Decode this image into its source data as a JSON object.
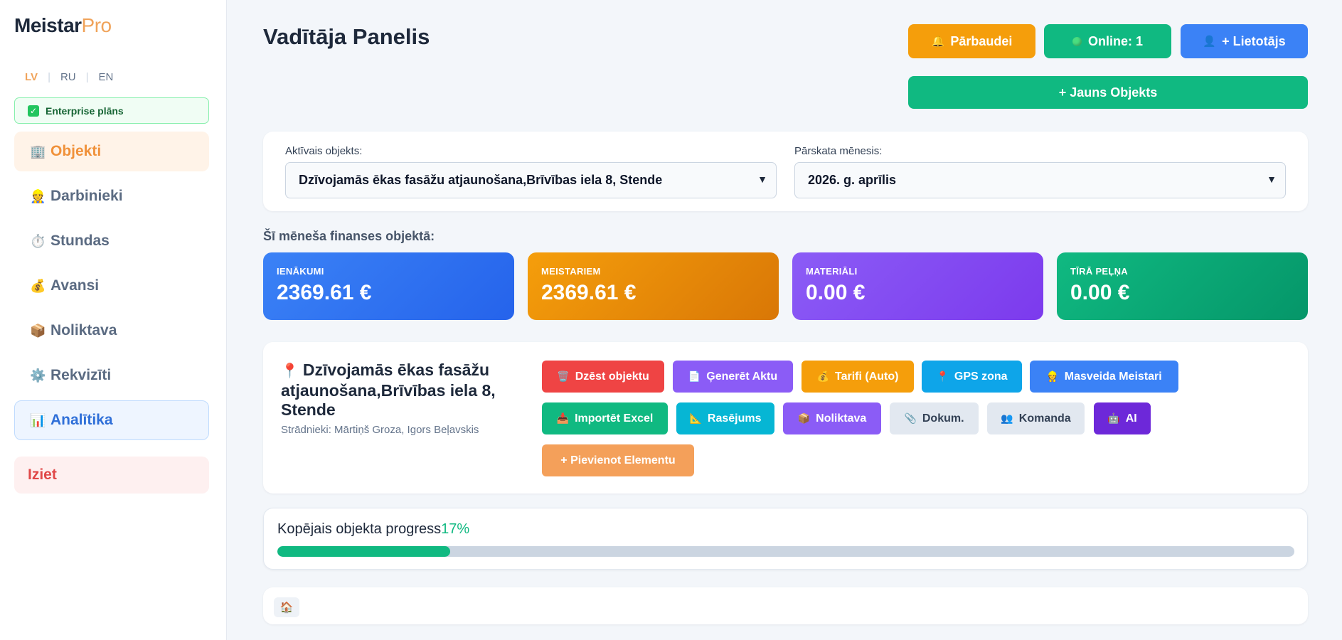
{
  "app": {
    "name_main": "Meistar",
    "name_accent": "Pro"
  },
  "languages": [
    {
      "code": "LV",
      "active": true
    },
    {
      "code": "RU",
      "active": false
    },
    {
      "code": "EN",
      "active": false
    }
  ],
  "plan": {
    "label": "Enterprise plāns",
    "icon": "check-icon"
  },
  "sidebar": {
    "items": [
      {
        "label": "Objekti",
        "icon": "🏢",
        "active": true
      },
      {
        "label": "Darbinieki",
        "icon": "👷"
      },
      {
        "label": "Stundas",
        "icon": "⏱️"
      },
      {
        "label": "Avansi",
        "icon": "💰"
      },
      {
        "label": "Noliktava",
        "icon": "📦"
      },
      {
        "label": "Rekvizīti",
        "icon": "⚙️"
      },
      {
        "label": "Analītika",
        "icon": "📊"
      }
    ],
    "logout": "Iziet"
  },
  "header": {
    "title": "Vadītāja Panelis",
    "check_button": "Pārbaudei",
    "check_icon": "🔔",
    "online_button": "Online: 1",
    "user_button": "+ Lietotājs",
    "user_icon": "👤",
    "new_object_button": "+ Jauns Objekts"
  },
  "filters": {
    "object_label": "Aktīvais objekts:",
    "object_value": "Dzīvojamās ēkas fasāžu atjaunošana,Brīvības iela 8, Stende",
    "month_label": "Pārskata mēnesis:",
    "month_value": "2026. g. aprīlis"
  },
  "finance": {
    "section_title": "Šī mēneša finanses objektā:",
    "income": {
      "label": "IENĀKUMI",
      "value": "2369.61 €"
    },
    "masters": {
      "label": "MEISTARIEM",
      "value": "2369.61 €"
    },
    "materials": {
      "label": "MATERIĀLI",
      "value": "0.00 €"
    },
    "profit": {
      "label": "TĪRĀ PEĻŅA",
      "value": "0.00 €"
    }
  },
  "object": {
    "title": "Dzīvojamās ēkas fasāžu atjaunošana,Brīvības iela 8, Stende",
    "pin_icon": "📍",
    "workers": "Strādnieki: Mārtiņš Groza, Igors Beļavskis",
    "actions": {
      "delete": {
        "label": "Dzēst objektu",
        "icon": "🗑️"
      },
      "act": {
        "label": "Ģenerēt Aktu",
        "icon": "📄"
      },
      "tariffs": {
        "label": "Tarifi (Auto)",
        "icon": "💰"
      },
      "gps": {
        "label": "GPS zona",
        "icon": "📍"
      },
      "bulk": {
        "label": "Masveida Meistari",
        "icon": "👷"
      },
      "import": {
        "label": "Importēt Excel",
        "icon": "📥"
      },
      "drawing": {
        "label": "Rasējums",
        "icon": "📐"
      },
      "warehouse": {
        "label": "Noliktava",
        "icon": "📦"
      },
      "docs": {
        "label": "Dokum.",
        "icon": "📎"
      },
      "team": {
        "label": "Komanda",
        "icon": "👥"
      },
      "ai": {
        "label": "AI",
        "icon": "🤖"
      },
      "add_element": {
        "label": "+ Pievienot Elementu"
      }
    }
  },
  "progress": {
    "label": "Kopējais objekta progress",
    "percent_text": "17%",
    "fraction": 0.17
  },
  "bottom": {
    "chip_icon": "🏠"
  },
  "colors": {
    "accent_orange": "#f0a35a",
    "green": "#10b981",
    "blue": "#3b82f6",
    "amber": "#f59e0b",
    "purple": "#8b5cf6",
    "red": "#ef4444",
    "cyan": "#06b6d4",
    "dark_purple": "#6d28d9"
  }
}
